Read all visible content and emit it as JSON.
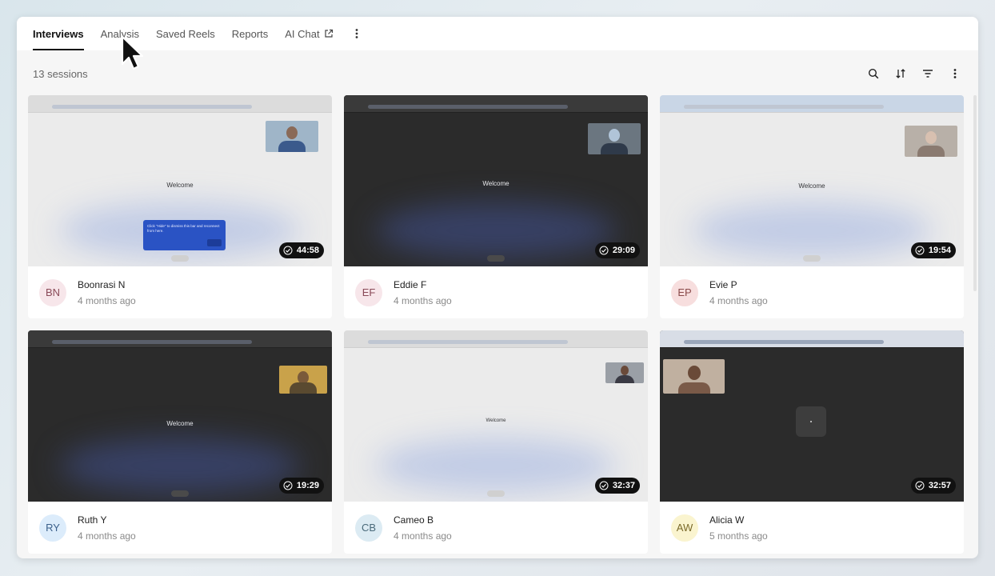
{
  "tabs": [
    {
      "label": "Interviews",
      "active": true
    },
    {
      "label": "Analysis",
      "active": false
    },
    {
      "label": "Saved Reels",
      "active": false
    },
    {
      "label": "Reports",
      "active": false
    },
    {
      "label": "AI Chat",
      "active": false,
      "icon": "external-link-icon"
    }
  ],
  "toolbar": {
    "sessions_count": "13 sessions",
    "icons": [
      "search-icon",
      "sort-icon",
      "filter-icon",
      "more-vertical-icon"
    ]
  },
  "thumbnail_text": {
    "welcome": "Welcome",
    "hint_popup": "Click \"Hide\" to dismiss this bar and reconnect from here."
  },
  "sessions": [
    {
      "initials": "BN",
      "name": "Boonrasi N",
      "time": "4 months ago",
      "duration": "44:58",
      "theme": "light",
      "avatar_bg": "#f7e6ea",
      "avatar_fg": "#8a4a58"
    },
    {
      "initials": "EF",
      "name": "Eddie F",
      "time": "4 months ago",
      "duration": "29:09",
      "theme": "dark",
      "avatar_bg": "#f7e6ea",
      "avatar_fg": "#8a4a58"
    },
    {
      "initials": "EP",
      "name": "Evie P",
      "time": "4 months ago",
      "duration": "19:54",
      "theme": "light",
      "avatar_bg": "#f7dede",
      "avatar_fg": "#8a4a4a"
    },
    {
      "initials": "RY",
      "name": "Ruth Y",
      "time": "4 months ago",
      "duration": "19:29",
      "theme": "dark",
      "avatar_bg": "#dcecfb",
      "avatar_fg": "#3a5f8a"
    },
    {
      "initials": "CB",
      "name": "Cameo B",
      "time": "4 months ago",
      "duration": "32:37",
      "theme": "light",
      "avatar_bg": "#dcebf3",
      "avatar_fg": "#4a6a7a"
    },
    {
      "initials": "AW",
      "name": "Alicia W",
      "time": "5 months ago",
      "duration": "32:57",
      "theme": "dark",
      "avatar_bg": "#faf4cf",
      "avatar_fg": "#7a6a2a"
    }
  ],
  "colors": {
    "active_tab_underline": "#111111",
    "duration_badge_bg": "#111111"
  }
}
